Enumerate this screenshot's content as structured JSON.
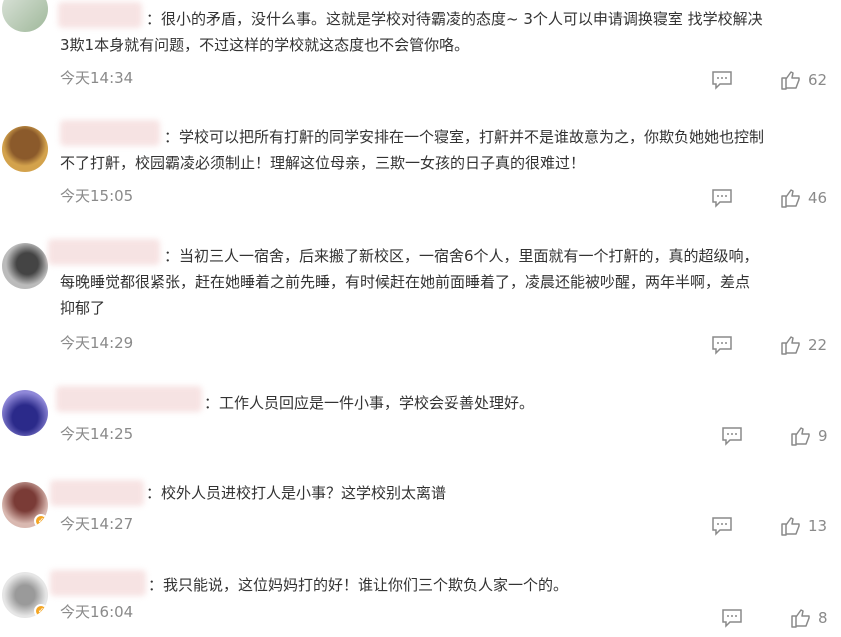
{
  "comments": [
    {
      "text_lines": [
        "：很小的矛盾，没什么事。这就是学校对待霸凌的态度~ 3个人可以申请调换寝室 找学校解决",
        "3欺1本身就有问题，不过这样的学校就这态度也不会管你咯。"
      ],
      "time": "今天14:34",
      "likes": "62",
      "avatar_colors": [
        "#cfd8cf",
        "#9fb89a"
      ]
    },
    {
      "text_lines": [
        "：学校可以把所有打鼾的同学安排在一个寝室，打鼾并不是谁故意为之，你欺负她她也控制",
        "不了打鼾，校园霸凌必须制止！理解这位母亲，三欺一女孩的日子真的很难过！"
      ],
      "time": "今天15:05",
      "likes": "46",
      "avatar_colors": [
        "#c08a3e",
        "#6b3b1a"
      ]
    },
    {
      "text_lines": [
        "：当初三人一宿舍，后来搬了新校区，一宿舍6个人，里面就有一个打鼾的，真的超级响，",
        "每晚睡觉都很紧张，赶在她睡着之前先睡，有时候赶在她前面睡着了，凌晨还能被吵醒，两年半啊，差点",
        "抑郁了"
      ],
      "time": "今天14:29",
      "likes": "22",
      "avatar_colors": [
        "#b9b9b9",
        "#555555"
      ]
    },
    {
      "text_lines": [
        "：工作人员回应是一件小事，学校会妥善处理好。"
      ],
      "time": "今天14:25",
      "likes": "9",
      "avatar_colors": [
        "#8f88d8",
        "#2b2a8a"
      ]
    },
    {
      "text_lines": [
        "：校外人员进校打人是小事？这学校别太离谱"
      ],
      "time": "今天14:27",
      "likes": "13",
      "avatar_colors": [
        "#d9b8b0",
        "#7a3b36"
      ]
    },
    {
      "text_lines": [
        "：我只能说，这位妈妈打的好！谁让你们三个欺负人家一个的。"
      ],
      "time": "今天16:04",
      "likes": "8",
      "avatar_colors": [
        "#e0e0e0",
        "#9a9a9a"
      ]
    }
  ],
  "icons": {
    "comment": "comment-icon",
    "like": "thumbs-up-icon",
    "verified": "verified-badge-icon"
  }
}
